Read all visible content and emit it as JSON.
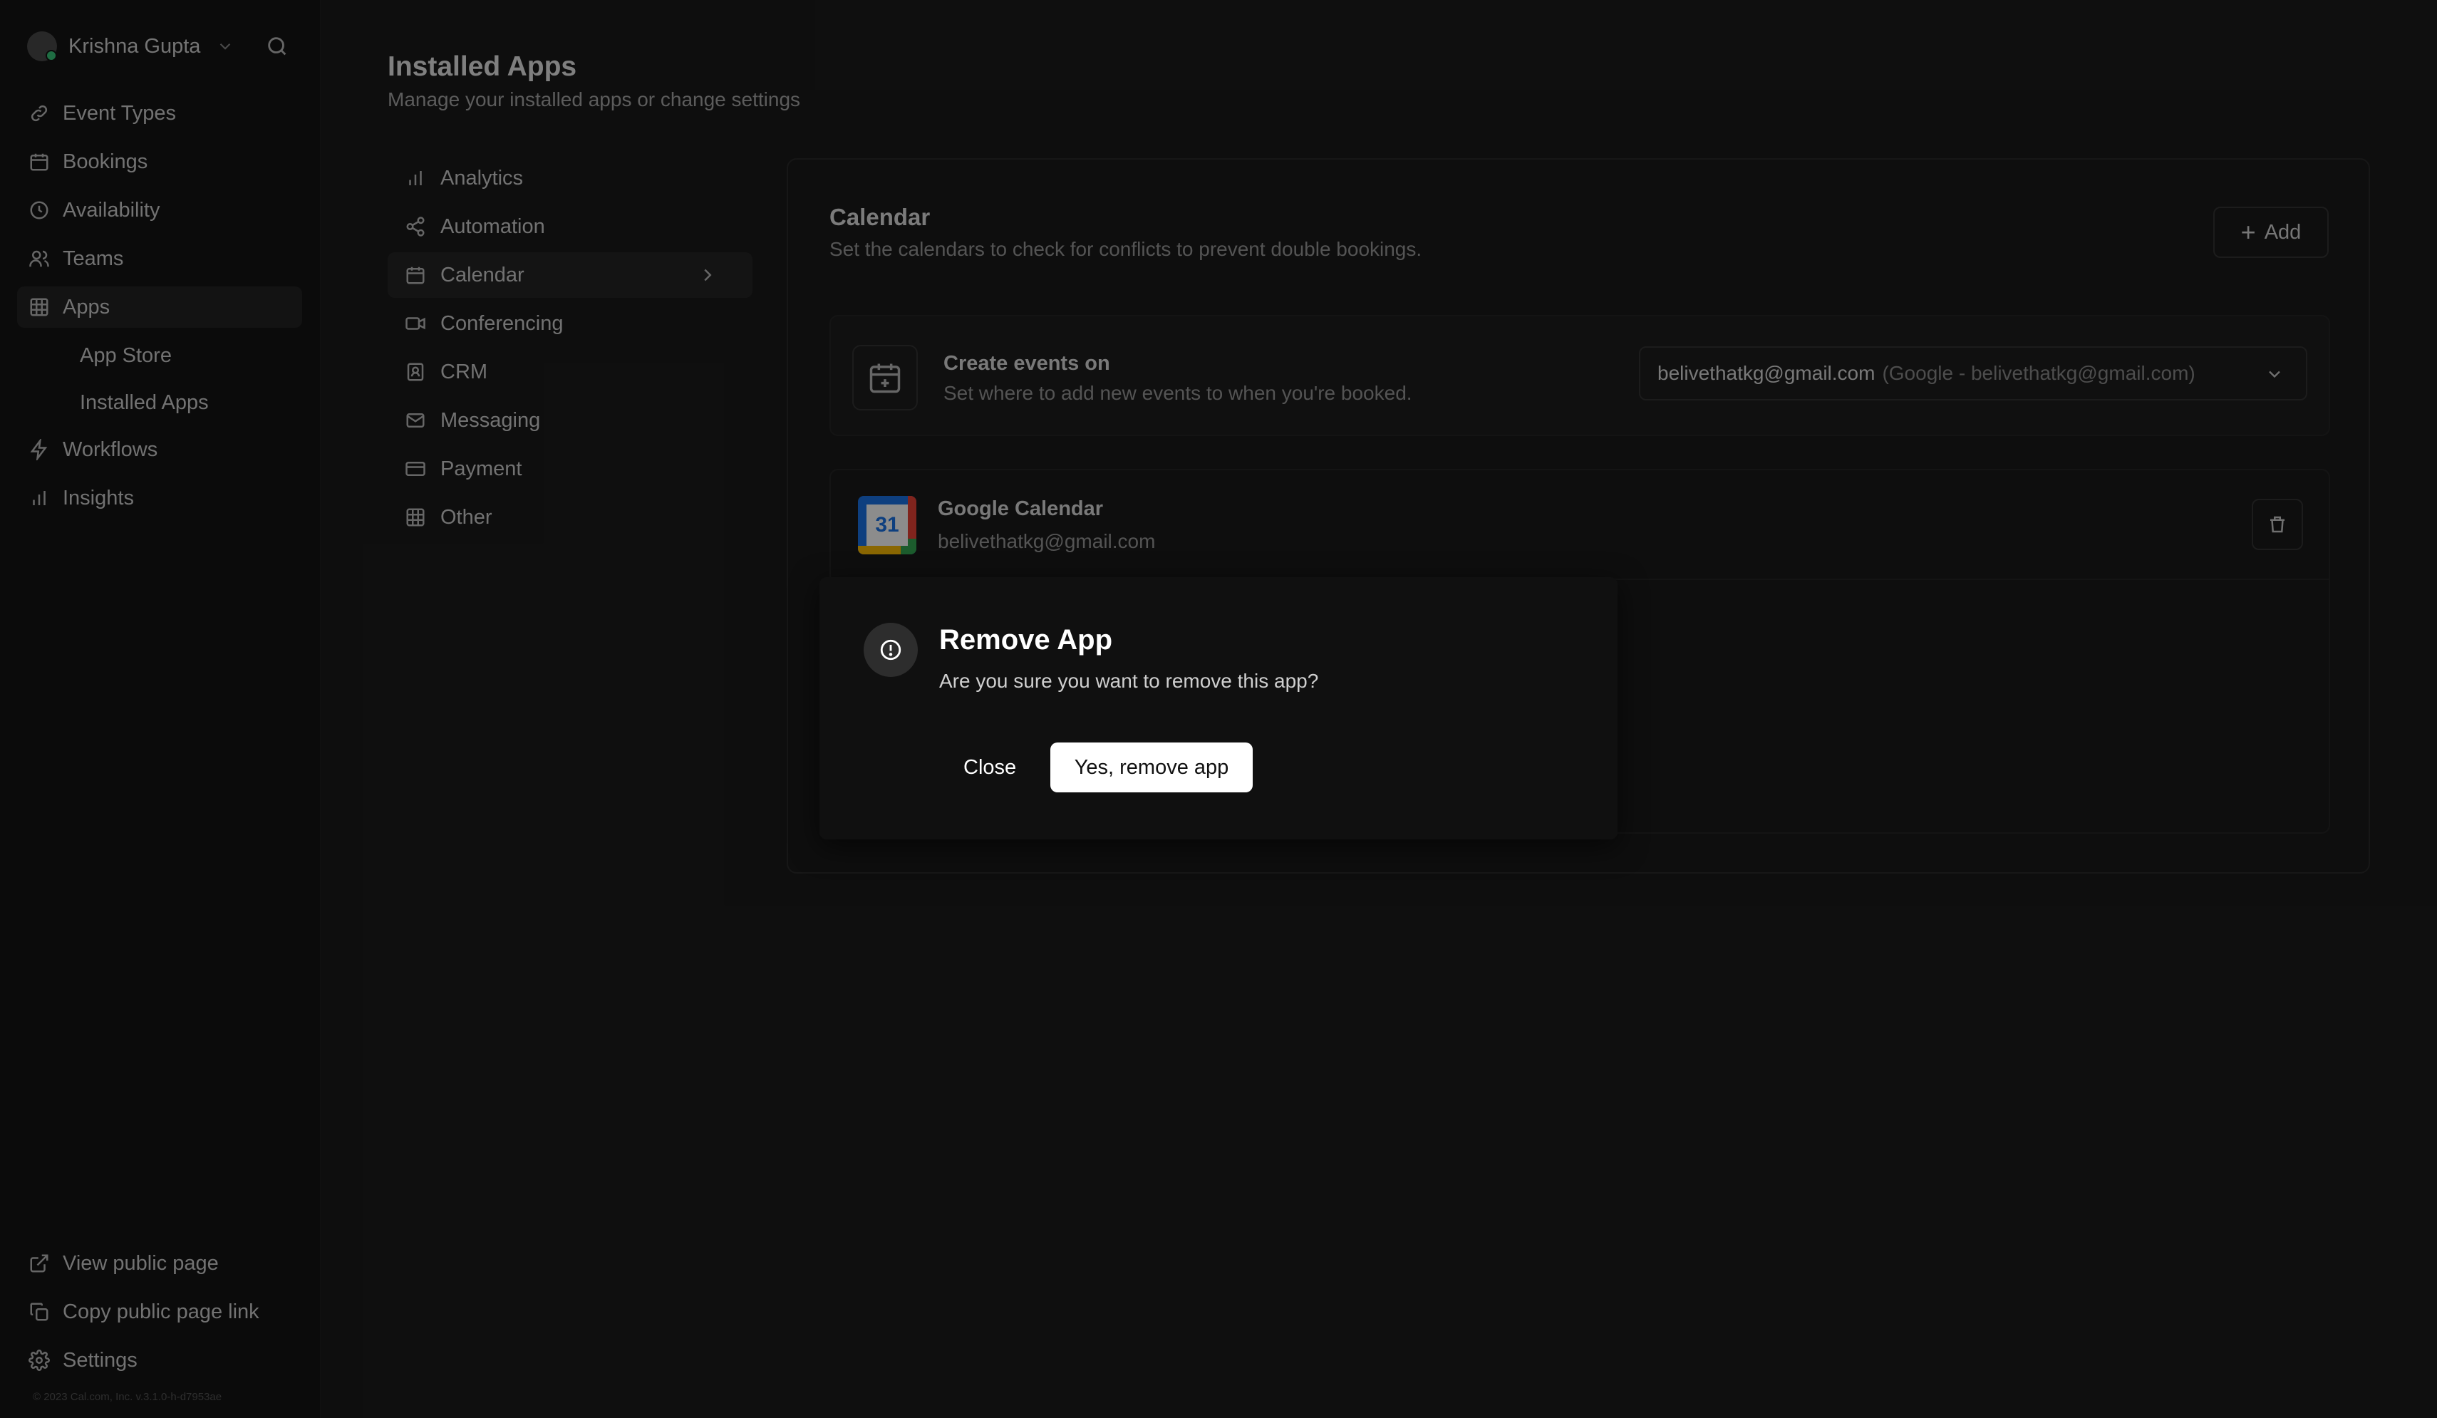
{
  "sidebar": {
    "user_name": "Krishna Gupta",
    "nav": [
      {
        "label": "Event Types",
        "icon": "link-icon"
      },
      {
        "label": "Bookings",
        "icon": "calendar-icon"
      },
      {
        "label": "Availability",
        "icon": "clock-icon"
      },
      {
        "label": "Teams",
        "icon": "users-icon"
      },
      {
        "label": "Apps",
        "icon": "grid-icon"
      }
    ],
    "apps_sub": [
      "App Store",
      "Installed Apps"
    ],
    "nav_after": [
      {
        "label": "Workflows",
        "icon": "zap-icon"
      },
      {
        "label": "Insights",
        "icon": "bar-chart-icon"
      }
    ],
    "bottom": [
      {
        "label": "View public page",
        "icon": "external-link-icon"
      },
      {
        "label": "Copy public page link",
        "icon": "copy-icon"
      },
      {
        "label": "Settings",
        "icon": "gear-icon"
      }
    ],
    "footer": "© 2023 Cal.com, Inc. v.3.1.0-h-d7953ae"
  },
  "main": {
    "title": "Installed Apps",
    "subtitle": "Manage your installed apps or change settings",
    "categories": [
      "Analytics",
      "Automation",
      "Calendar",
      "Conferencing",
      "CRM",
      "Messaging",
      "Payment",
      "Other"
    ],
    "active_category": "Calendar",
    "panel": {
      "title": "Calendar",
      "subtitle": "Set the calendars to check for conflicts to prevent double bookings.",
      "add_label": "Add",
      "create_events": {
        "title": "Create events on",
        "subtitle": "Set where to add new events to when you're booked.",
        "selected_value": "belivethatkg@gmail.com",
        "selected_detail": "(Google - belivethatkg@gmail.com)"
      },
      "google_calendar": {
        "name": "Google Calendar",
        "email": "belivethatkg@gmail.com",
        "logo_text": "31"
      }
    }
  },
  "modal": {
    "title": "Remove App",
    "text": "Are you sure you want to remove this app?",
    "close_label": "Close",
    "confirm_label": "Yes, remove app"
  }
}
